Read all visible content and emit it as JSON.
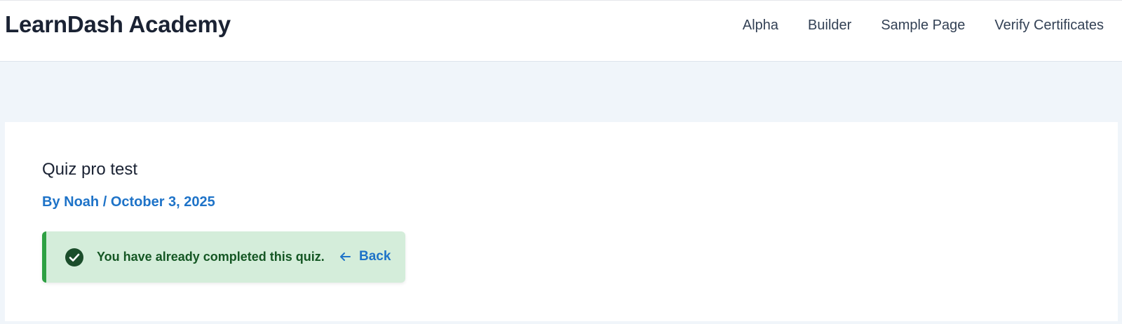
{
  "header": {
    "site_title": "LearnDash Academy",
    "nav": [
      {
        "label": "Alpha"
      },
      {
        "label": "Builder"
      },
      {
        "label": "Sample Page"
      },
      {
        "label": "Verify Certificates"
      }
    ]
  },
  "post": {
    "title": "Quiz pro test",
    "meta": {
      "by": "By",
      "author": "Noah",
      "separator": "/",
      "date": "October 3, 2025"
    }
  },
  "alert": {
    "icon": "check-circle-icon",
    "message": "You have already completed this quiz.",
    "back_label": "Back",
    "back_icon": "arrow-left-icon"
  },
  "colors": {
    "page_background": "#f0f5fa",
    "link": "#1e73c8",
    "alert_background": "#d4edda",
    "alert_border": "#2ea043",
    "alert_text": "#155724"
  }
}
